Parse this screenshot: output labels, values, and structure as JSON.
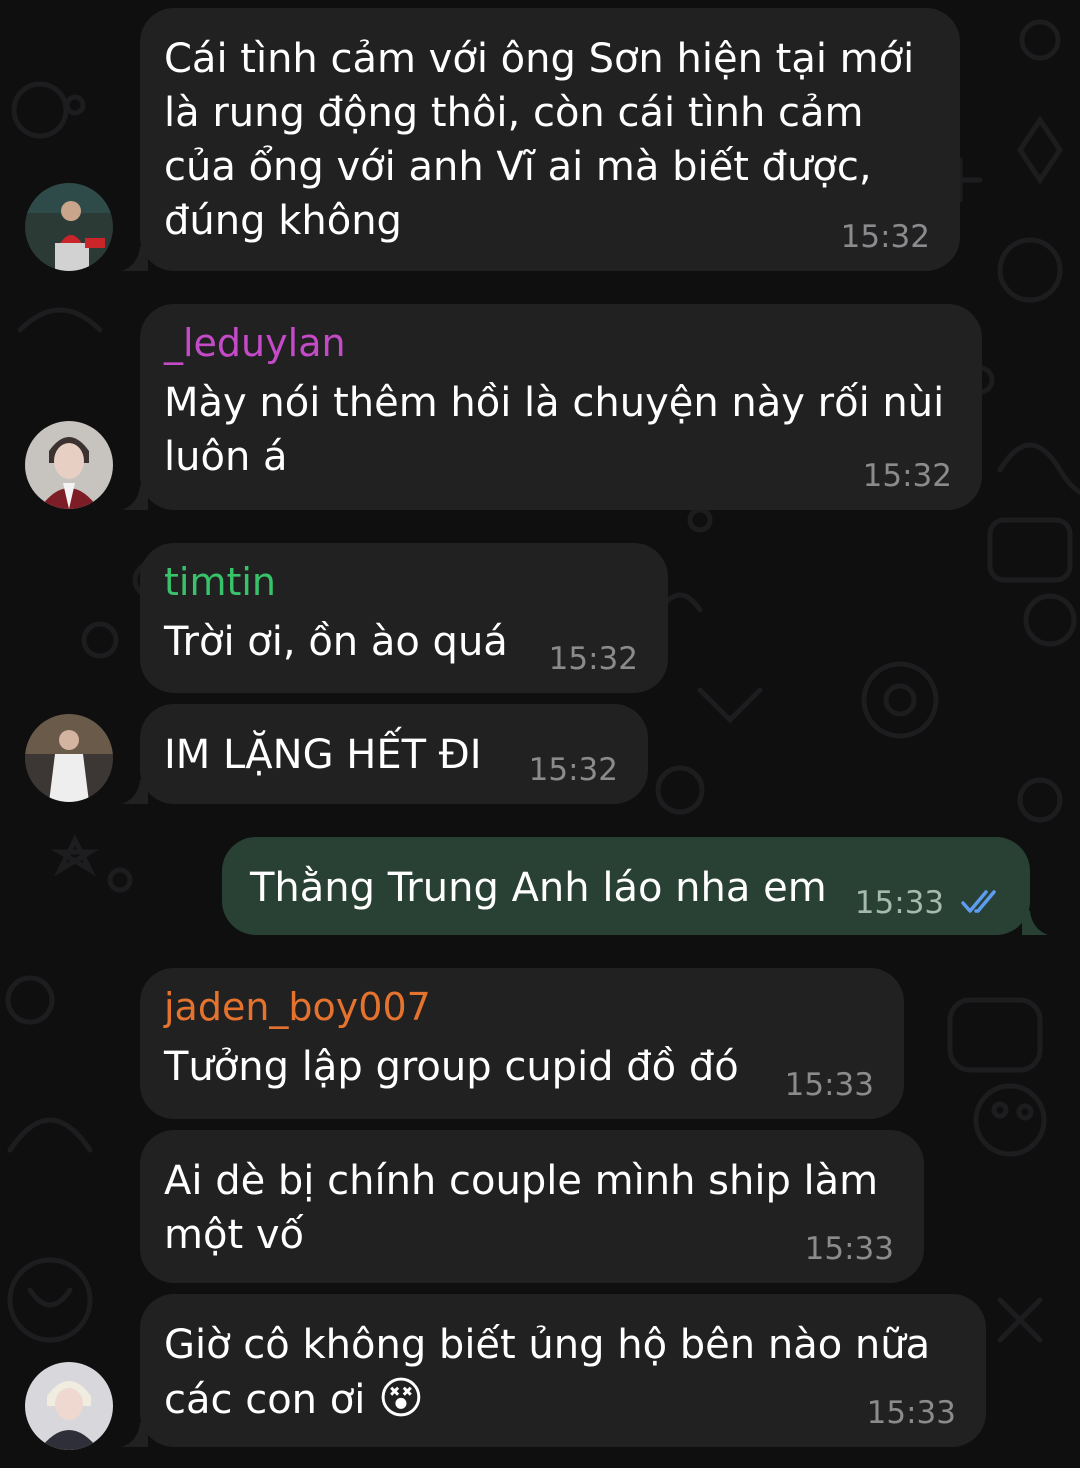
{
  "colors": {
    "incoming_bubble": "#212122",
    "outgoing_bubble": "#284134",
    "name_leduylan": "#c54ac8",
    "name_timtin": "#38c26a",
    "name_jaden": "#e5732e",
    "read_check": "#5d9cf0"
  },
  "messages": [
    {
      "text": "Cái tình cảm với ông Sơn hiện tại mới\nlà rung động thôi, còn cái tình cảm\ncủa ổng với anh Vĩ ai mà biết được,\nđúng không",
      "time": "15:32"
    },
    {
      "sender": "_leduylan",
      "text": "Mày nói thêm hồi là chuyện này rối nùi\nluôn á",
      "time": "15:32"
    },
    {
      "sender": "timtin",
      "text": "Trời ơi, ồn ào quá",
      "time": "15:32"
    },
    {
      "text": "IM LẶNG HẾT ĐI",
      "time": "15:32"
    },
    {
      "text": "Thằng Trung Anh láo nha em",
      "time": "15:33",
      "status_icon": "double-check-icon"
    },
    {
      "sender": "jaden_boy007",
      "text": "Tưởng lập group cupid đồ đó",
      "time": "15:33"
    },
    {
      "text": "Ai dè bị chính couple mình ship làm\nmột vố",
      "time": "15:33"
    },
    {
      "text": "Giờ cô không biết ủng hộ bên nào nữa\ncác con ơi",
      "emoji": "😵",
      "time": "15:33"
    }
  ]
}
